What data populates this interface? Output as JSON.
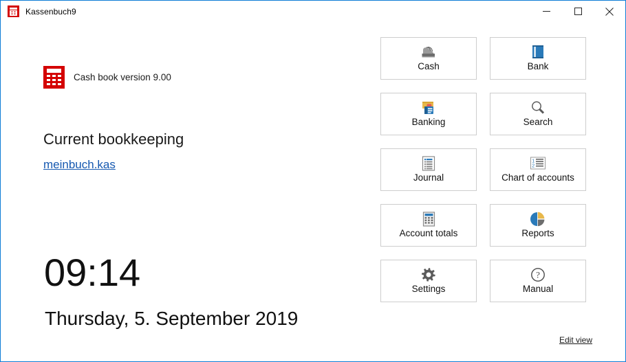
{
  "window": {
    "title": "Kassenbuch9",
    "app_icon": "calculator-icon",
    "border_color": "#0c7cd5",
    "controls": {
      "minimize": "minimize-icon",
      "maximize": "maximize-icon",
      "close": "close-icon"
    }
  },
  "left_panel": {
    "version_icon": "calculator-icon",
    "version_text": "Cash book version 9.00",
    "heading": "Current bookkeeping",
    "file_link": "meinbuch.kas",
    "clock": "09:14",
    "date": "Thursday, 5. September 2019"
  },
  "tiles": [
    {
      "label": "Cash",
      "icon": "cash-drawer-icon"
    },
    {
      "label": "Bank",
      "icon": "book-icon"
    },
    {
      "label": "Banking",
      "icon": "payment-cards-icon"
    },
    {
      "label": "Search",
      "icon": "magnifier-icon"
    },
    {
      "label": "Journal",
      "icon": "list-document-icon"
    },
    {
      "label": "Chart of accounts",
      "icon": "numbered-list-icon"
    },
    {
      "label": "Account totals",
      "icon": "calculator-icon"
    },
    {
      "label": "Reports",
      "icon": "pie-chart-icon"
    },
    {
      "label": "Settings",
      "icon": "gear-icon"
    },
    {
      "label": "Manual",
      "icon": "question-mark-icon"
    }
  ],
  "footer": {
    "edit_view": "Edit view"
  },
  "colors": {
    "accent_blue": "#1a6fc4",
    "icon_gold": "#e8b84b",
    "icon_gray": "#6d6d6d",
    "brand_red": "#d40000",
    "link_blue": "#1558b0"
  }
}
